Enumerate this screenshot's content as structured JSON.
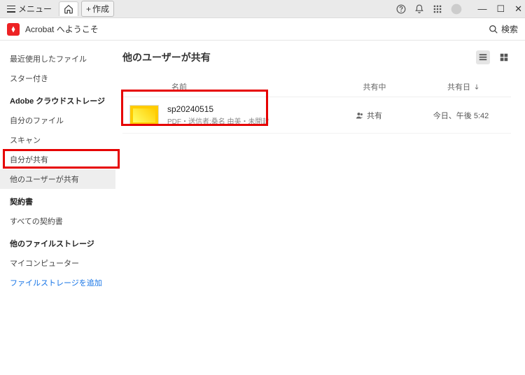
{
  "titlebar": {
    "menu": "メニュー",
    "create": "作成"
  },
  "subbar": {
    "welcome": "Acrobat へようこそ",
    "search": "検索"
  },
  "sidebar": {
    "recent": "最近使用したファイル",
    "starred": "スター付き",
    "cloud_heading": "Adobe クラウドストレージ",
    "my_files": "自分のファイル",
    "scan": "スキャン",
    "shared_by_me": "自分が共有",
    "shared_by_others": "他のユーザーが共有",
    "agreements_heading": "契約書",
    "all_agreements": "すべての契約書",
    "other_storage_heading": "他のファイルストレージ",
    "my_computer": "マイコンピューター",
    "add_storage": "ファイルストレージを追加"
  },
  "content": {
    "title": "他のユーザーが共有",
    "col_name": "名前",
    "col_shared": "共有中",
    "col_date": "共有日",
    "file": {
      "name": "sp20240515",
      "meta": "PDF・送信者:桑名 由美・未開封",
      "shared_label": "共有",
      "date": "今日、午後 5:42"
    }
  }
}
